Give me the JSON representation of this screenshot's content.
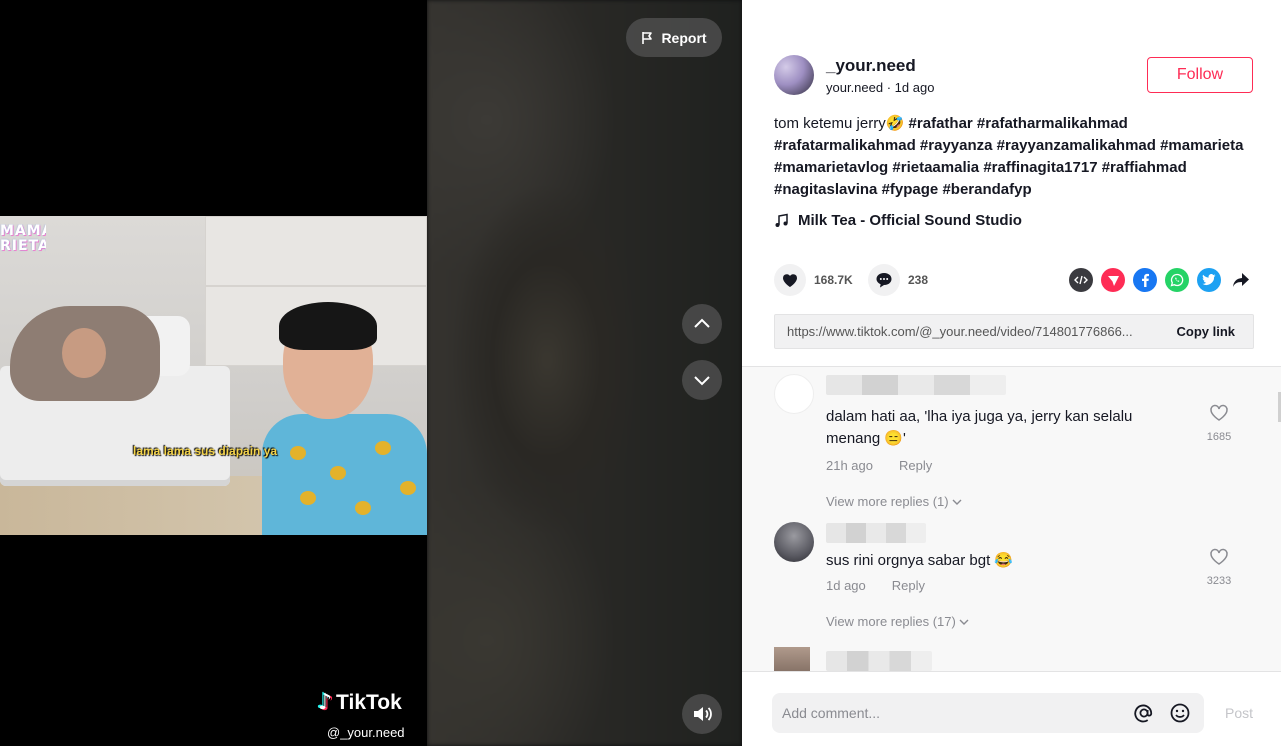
{
  "video": {
    "report_label": "Report",
    "overlay_subtitle": "lama lama sus diapain ya",
    "corner_watermark": "MAMA RIETA",
    "watermark_brand": "TikTok",
    "watermark_handle": "@_your.need"
  },
  "author": {
    "username": "_your.need",
    "nickname": "your.need",
    "time": "1d ago",
    "follow_label": "Follow"
  },
  "caption": {
    "text": "tom ketemu jerry🤣",
    "hashtags": [
      "#rafathar",
      "#rafatharmalikahmad",
      "#rafatarmalikahmad",
      "#rayyanza",
      "#rayyanzamalikahmad",
      "#mamarieta",
      "#mamarietavlog",
      "#rietaamalia",
      "#raffinagita1717",
      "#raffiahmad",
      "#nagitaslavina",
      "#fypage",
      "#berandafyp"
    ]
  },
  "music": {
    "title": "Milk Tea - Official Sound Studio"
  },
  "stats": {
    "likes": "168.7K",
    "comments": "238"
  },
  "share": {
    "icons": [
      "embed-icon",
      "send-to-friends-icon",
      "facebook-icon",
      "whatsapp-icon",
      "twitter-icon",
      "share-arrow-icon"
    ],
    "colors": {
      "embed": "#3a3a3f",
      "send": "#fe2c55",
      "facebook": "#1877f2",
      "whatsapp": "#25d366",
      "twitter": "#1da1f2"
    }
  },
  "link": {
    "url": "https://www.tiktok.com/@_your.need/video/714801776866...",
    "copy_label": "Copy link"
  },
  "comments": [
    {
      "text": "dalam hati aa, 'lha iya juga ya, jerry kan selalu menang 😑'",
      "time": "21h ago",
      "reply_label": "Reply",
      "likes": "1685",
      "view_replies": "View more replies (1)"
    },
    {
      "text": "sus rini orgnya sabar bgt 😂",
      "time": "1d ago",
      "reply_label": "Reply",
      "likes": "3233",
      "view_replies": "View more replies (17)"
    }
  ],
  "comment_bar": {
    "placeholder": "Add comment...",
    "post_label": "Post"
  },
  "colors": {
    "accent": "#fe2c55",
    "text": "#161823",
    "muted": "#8a8b91"
  }
}
